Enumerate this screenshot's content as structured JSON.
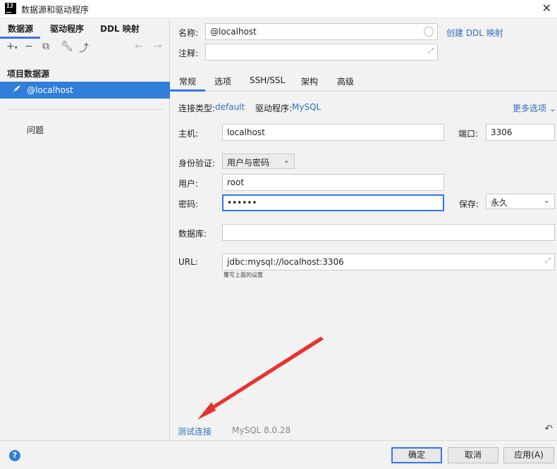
{
  "window": {
    "title": "数据源和驱动程序",
    "app_icon_text": "IJ",
    "close_glyph": "✕"
  },
  "sidebar": {
    "tabs": [
      "数据源",
      "驱动程序",
      "DDL 映射"
    ],
    "toolbar_icons": [
      "add-icon",
      "remove-icon",
      "copy-icon",
      "wrench-icon",
      "export-icon",
      "back-icon",
      "forward-icon"
    ],
    "section_title": "项目数据源",
    "selected_item": "@localhost",
    "problems_label": "问题"
  },
  "main": {
    "name_label": "名称:",
    "name_value": "@localhost",
    "create_ddl_link": "创建 DDL 映射",
    "comment_label": "注释:",
    "comment_value": "",
    "tabs": [
      "常规",
      "选项",
      "SSH/SSL",
      "架构",
      "高级"
    ],
    "conn_type_label": "连接类型:",
    "conn_type_value": "default",
    "driver_label": "驱动程序:",
    "driver_value": "MySQL",
    "more_options": "更多选项",
    "host_label": "主机:",
    "host_value": "localhost",
    "port_label": "端口:",
    "port_value": "3306",
    "auth_label": "身份验证:",
    "auth_value": "用户与密码",
    "user_label": "用户:",
    "user_value": "root",
    "password_label": "密码:",
    "password_value": "••••••",
    "save_label": "保存:",
    "save_value": "永久",
    "database_label": "数据库:",
    "database_value": "",
    "url_label": "URL:",
    "url_value": "jdbc:mysql://localhost:3306",
    "url_hint": "覆写上面的设置",
    "test_connection": "测试连接",
    "driver_version": "MySQL 8.0.28"
  },
  "footer": {
    "help": "?",
    "ok": "确定",
    "cancel": "取消",
    "apply": "应用(A)"
  },
  "colors": {
    "accent": "#3574f0",
    "selection": "#2f7ed8",
    "link": "#2f6fbe",
    "arrow": "#e8322f"
  }
}
